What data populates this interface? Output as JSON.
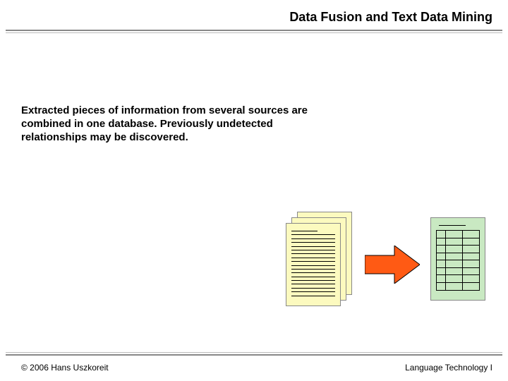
{
  "title": "Data Fusion and Text Data Mining",
  "body": "Extracted pieces of information from several sources are combined in one database. Previously undetected relationships may be discovered.",
  "footer": {
    "left": "© 2006 Hans Uszkoreit",
    "right": "Language Technology I"
  },
  "colors": {
    "document": "#fcfabf",
    "database": "#c9e9c2",
    "arrow_fill": "#ff5a14",
    "arrow_stroke": "#000000"
  },
  "icons": {
    "documents": "document-stack-icon",
    "arrow": "arrow-right-icon",
    "database": "database-table-icon"
  }
}
